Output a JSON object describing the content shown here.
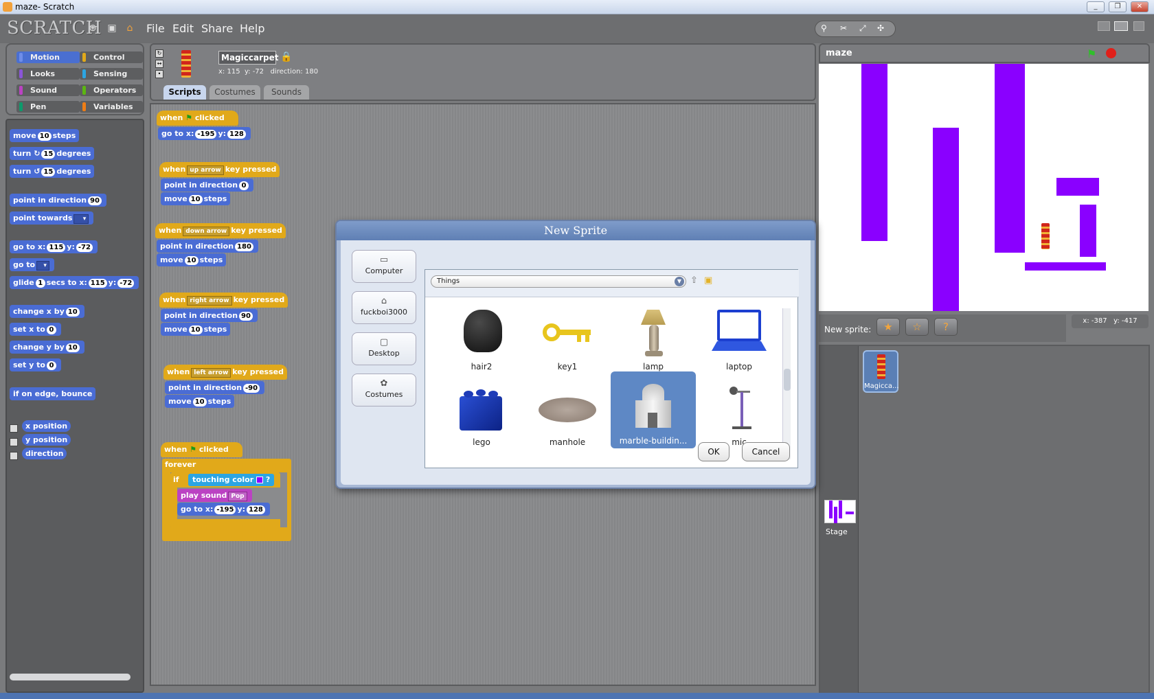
{
  "window": {
    "title": "maze- Scratch",
    "controls": [
      "minimize",
      "restore",
      "close"
    ]
  },
  "menubar": {
    "logo": "SCRATCH",
    "file": "File",
    "edit": "Edit",
    "share": "Share",
    "help": "Help"
  },
  "categories": [
    {
      "label": "Motion",
      "color": "#4a6cd4"
    },
    {
      "label": "Control",
      "color": "#e1a91a"
    },
    {
      "label": "Looks",
      "color": "#8a55d7"
    },
    {
      "label": "Sensing",
      "color": "#2ca5e2"
    },
    {
      "label": "Sound",
      "color": "#bb42c3"
    },
    {
      "label": "Operators",
      "color": "#5cb712"
    },
    {
      "label": "Pen",
      "color": "#0e9a6c"
    },
    {
      "label": "Variables",
      "color": "#ee7d16"
    }
  ],
  "palette": {
    "move": "move",
    "move_val": "10",
    "move_unit": "steps",
    "turn_right": "turn",
    "turn_right_val": "15",
    "turn_deg": "degrees",
    "turn_left": "turn",
    "turn_left_val": "15",
    "point_dir": "point in direction",
    "point_dir_val": "90",
    "point_towards": "point towards",
    "goto_xy": "go to x:",
    "goto_x": "115",
    "y_label": "y:",
    "goto_y": "-72",
    "goto": "go to",
    "glide": "glide",
    "glide_secs": "1",
    "glide_to": "secs to x:",
    "glide_x": "115",
    "glide_y": "-72",
    "change_x": "change x by",
    "change_x_val": "10",
    "set_x": "set x to",
    "set_x_val": "0",
    "change_y": "change y by",
    "change_y_val": "10",
    "set_y": "set y to",
    "set_y_val": "0",
    "bounce": "if on edge, bounce",
    "xpos": "x position",
    "ypos": "y position",
    "direction": "direction"
  },
  "sprite": {
    "name": "Magiccarpet",
    "x_label": "x:",
    "x": "115",
    "y_label": "y:",
    "y": "-72",
    "dir_label": "direction:",
    "dir": "180"
  },
  "tabs": {
    "scripts": "Scripts",
    "costumes": "Costumes",
    "sounds": "Sounds"
  },
  "scripts": {
    "when": "when",
    "clicked": "clicked",
    "key_pressed": "key pressed",
    "goto": "go to x:",
    "y": "y:",
    "start_x": "-195",
    "start_y": "128",
    "point_dir": "point in direction",
    "move": "move",
    "steps": "steps",
    "ten": "10",
    "up": "up arrow",
    "up_dir": "0",
    "down": "down arrow",
    "down_dir": "180",
    "right": "right arrow",
    "right_dir": "90",
    "left": "left arrow",
    "left_dir": "-90",
    "forever": "forever",
    "if": "if",
    "touching": "touching color",
    "q": "?",
    "play_sound": "play sound",
    "sound": "Pop"
  },
  "stage": {
    "title": "maze",
    "mouse_x": "x: -387",
    "mouse_y": "y: -417",
    "wall_color": "#8a00ff"
  },
  "sprites_panel": {
    "new_sprite": "New sprite:",
    "sprite_label": "Magicca...",
    "stage_label": "Stage"
  },
  "dialog": {
    "title": "New Sprite",
    "places": [
      "Computer",
      "fuckboi3000",
      "Desktop",
      "Costumes"
    ],
    "folder": "Things",
    "items": [
      "hair2",
      "key1",
      "lamp",
      "laptop",
      "lego",
      "manhole",
      "marble-buildin...",
      "mic"
    ],
    "selected": "marble-buildin...",
    "ok": "OK",
    "cancel": "Cancel"
  }
}
